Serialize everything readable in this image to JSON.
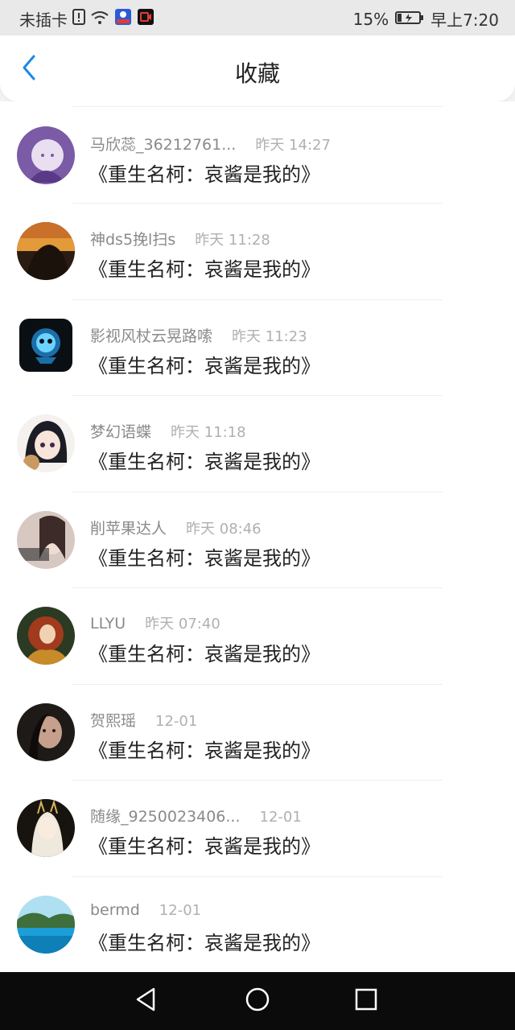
{
  "status_bar": {
    "carrier": "未插卡",
    "battery": "15%",
    "time": "早上7:20"
  },
  "header": {
    "title": "收藏",
    "back_icon": "chevron-left-icon"
  },
  "items": [
    {
      "user": "马欣蕊_36212761...",
      "time": "昨天 14:27",
      "title": "《重生名柯：哀酱是我的》"
    },
    {
      "user": "神ds5挽l扫s",
      "time": "昨天 11:28",
      "title": "《重生名柯：哀酱是我的》"
    },
    {
      "user": "影视风杖云晃路嗦",
      "time": "昨天 11:23",
      "title": "《重生名柯：哀酱是我的》"
    },
    {
      "user": "梦幻语蝶",
      "time": "昨天 11:18",
      "title": "《重生名柯：哀酱是我的》"
    },
    {
      "user": "削苹果达人",
      "time": "昨天 08:46",
      "title": "《重生名柯：哀酱是我的》"
    },
    {
      "user": "LLYU",
      "time": "昨天 07:40",
      "title": "《重生名柯：哀酱是我的》"
    },
    {
      "user": "贺熙瑶",
      "time": "12-01",
      "title": "《重生名柯：哀酱是我的》"
    },
    {
      "user": "随缘_9250023406...",
      "time": "12-01",
      "title": "《重生名柯：哀酱是我的》"
    },
    {
      "user": "bermd",
      "time": "12-01",
      "title": "《重生名柯：哀酱是我的》"
    }
  ],
  "colors": {
    "accent": "#1e88e5",
    "nav_bar": "#0b0b0b"
  }
}
